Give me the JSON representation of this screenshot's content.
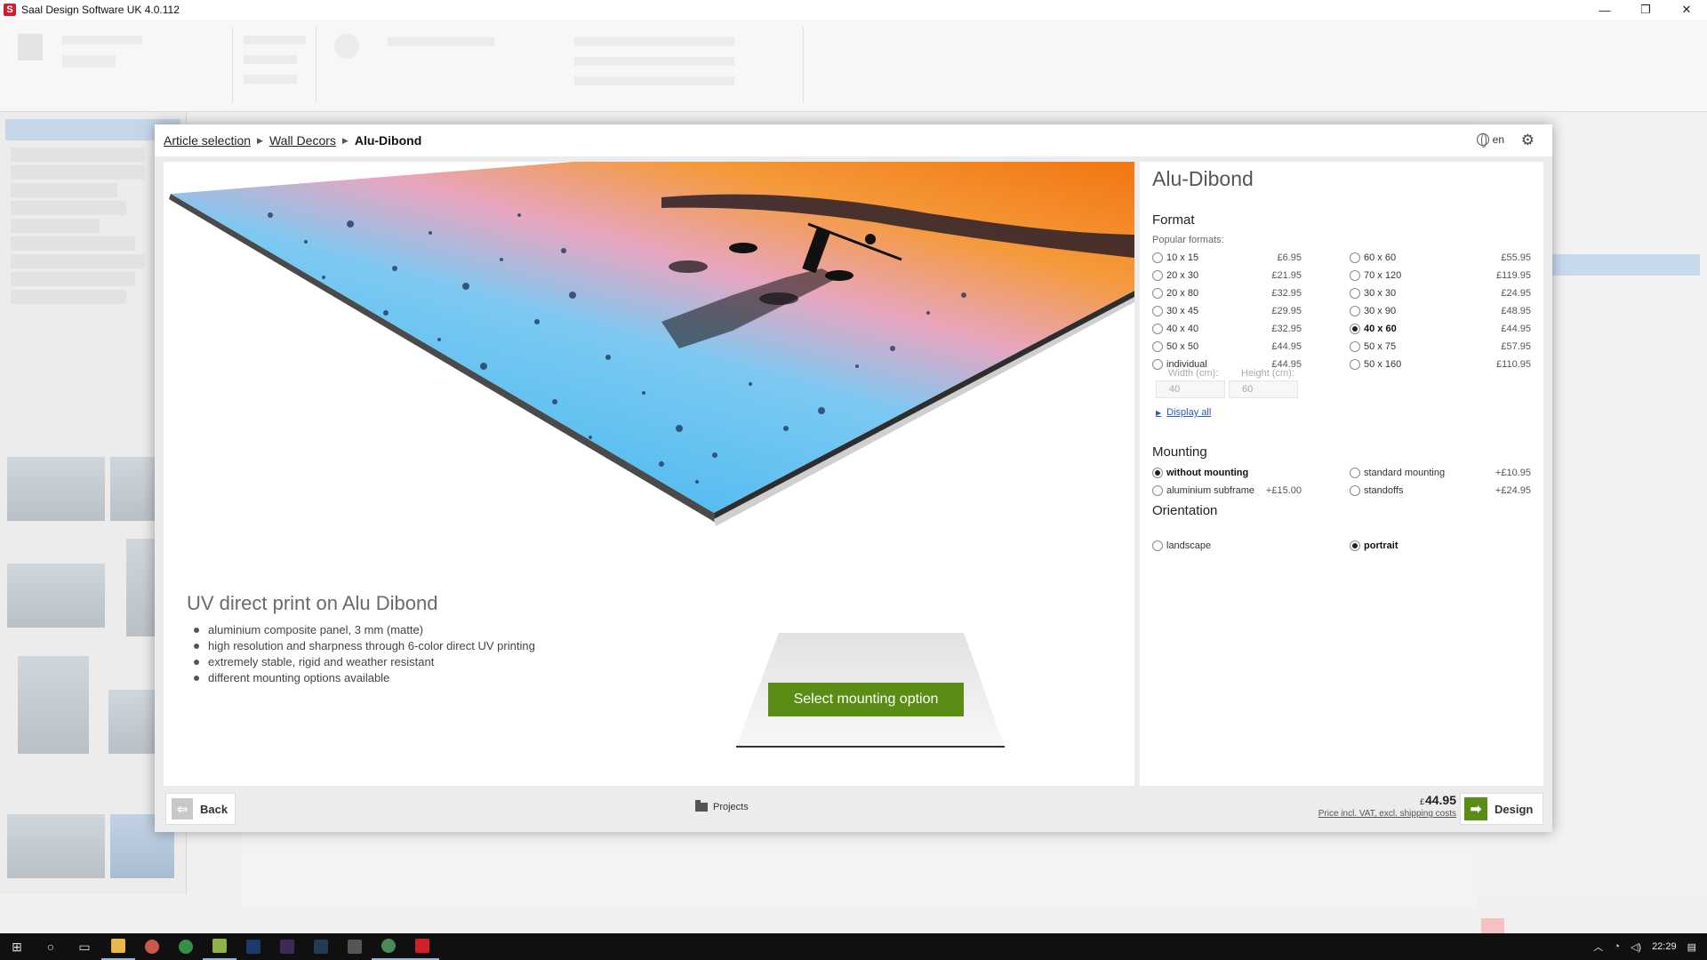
{
  "window": {
    "title": "Saal Design Software UK 4.0.112",
    "minimize": "—",
    "restore": "❐",
    "close": "✕"
  },
  "dialog": {
    "breadcrumb": [
      "Article selection",
      "Wall Decors"
    ],
    "current": "Alu-Dibond",
    "language": "en"
  },
  "product": {
    "desc_title": "UV direct print on Alu Dibond",
    "features": [
      "aluminium composite panel, 3 mm (matte)",
      "high resolution and sharpness through 6-color direct UV printing",
      "extremely stable, rigid and weather resistant",
      "different mounting options available"
    ],
    "select_mounting_label": "Select mounting option"
  },
  "options": {
    "title": "Alu-Dibond",
    "format_title": "Format",
    "popular_label": "Popular formats:",
    "formats_left": [
      {
        "label": "10 x 15",
        "price": "£6.95"
      },
      {
        "label": "20 x 30",
        "price": "£21.95"
      },
      {
        "label": "20 x 80",
        "price": "£32.95"
      },
      {
        "label": "30 x 45",
        "price": "£29.95"
      },
      {
        "label": "40 x 40",
        "price": "£32.95"
      },
      {
        "label": "50 x 50",
        "price": "£44.95"
      },
      {
        "label": "individual",
        "price": "£44.95"
      }
    ],
    "formats_right": [
      {
        "label": "60 x 60",
        "price": "£55.95"
      },
      {
        "label": "70 x 120",
        "price": "£119.95"
      },
      {
        "label": "30 x 30",
        "price": "£24.95"
      },
      {
        "label": "30 x 90",
        "price": "£48.95"
      },
      {
        "label": "40 x 60",
        "price": "£44.95"
      },
      {
        "label": "50 x 75",
        "price": "£57.95"
      },
      {
        "label": "50 x 160",
        "price": "£110.95"
      }
    ],
    "selected_format": "40 x 60",
    "width_label": "Width (cm):",
    "width_value": "40",
    "height_label": "Height (cm):",
    "height_value": "60",
    "display_all": "Display all",
    "mounting_title": "Mounting",
    "mounting": [
      {
        "label": "without mounting",
        "price": ""
      },
      {
        "label": "standard mounting",
        "price": "+£10.95"
      },
      {
        "label": "aluminium subframe",
        "price": "+£15.00"
      },
      {
        "label": "standoffs",
        "price": "+£24.95"
      }
    ],
    "selected_mounting": "without mounting",
    "orientation_title": "Orientation",
    "orientation": [
      {
        "label": "landscape"
      },
      {
        "label": "portrait"
      }
    ],
    "selected_orientation": "portrait"
  },
  "footer": {
    "back_label": "Back",
    "projects_label": "Projects",
    "currency": "£",
    "price": "44.95",
    "price_note": "Price incl. VAT, excl. shipping costs",
    "design_label": "Design"
  },
  "taskbar": {
    "time": "22:29"
  },
  "colors": {
    "accent_green": "#5b8c14",
    "brand_red": "#d0202a"
  }
}
